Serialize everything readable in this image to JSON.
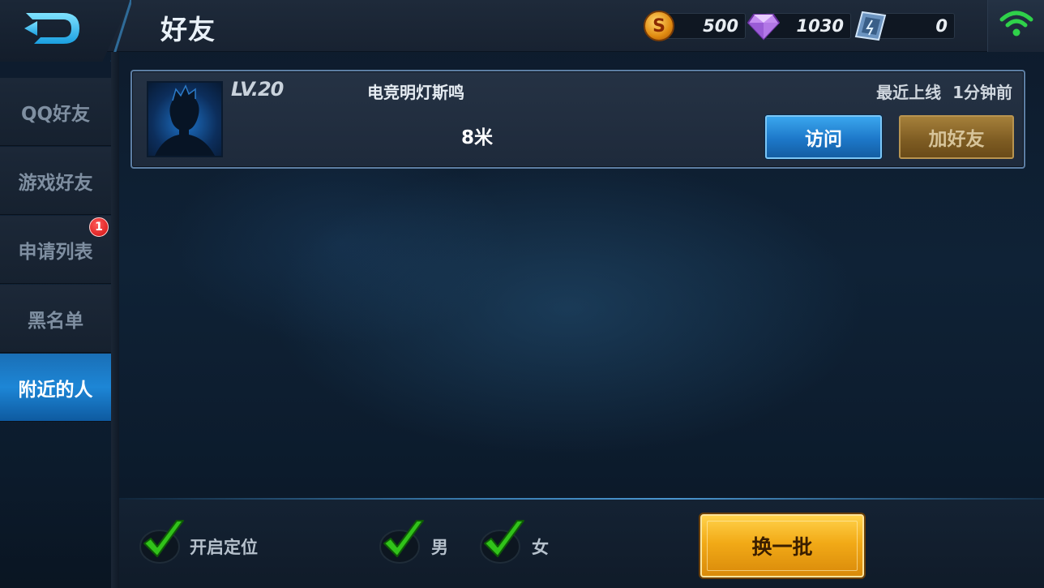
{
  "header": {
    "title": "好友",
    "coins": "500",
    "diamonds": "1030",
    "tickets": "0",
    "coin_icon": "gold-coin-icon",
    "diamond_icon": "diamond-icon",
    "ticket_icon": "ticket-icon",
    "wifi_icon": "wifi-icon",
    "back_icon": "back-arrow-icon"
  },
  "sidebar": {
    "items": [
      {
        "label": "QQ好友",
        "active": false
      },
      {
        "label": "游戏好友",
        "active": false
      },
      {
        "label": "申请列表",
        "active": false,
        "badge": "1"
      },
      {
        "label": "黑名单",
        "active": false
      },
      {
        "label": "附近的人",
        "active": true
      }
    ]
  },
  "friend": {
    "level": "LV.20",
    "name": "电竞明灯斯鸣",
    "distance": "8米",
    "online_label": "最近上线",
    "online_time": "1分钟前",
    "visit_label": "访问",
    "add_label": "加好友"
  },
  "filters": {
    "location_label": "开启定位",
    "male_label": "男",
    "female_label": "女"
  },
  "refresh_label": "换一批",
  "colors": {
    "accent_blue": "#1d86d6",
    "gold_button": "#f2aa17",
    "check_green": "#31c21a",
    "badge_red": "#d10e0e"
  }
}
